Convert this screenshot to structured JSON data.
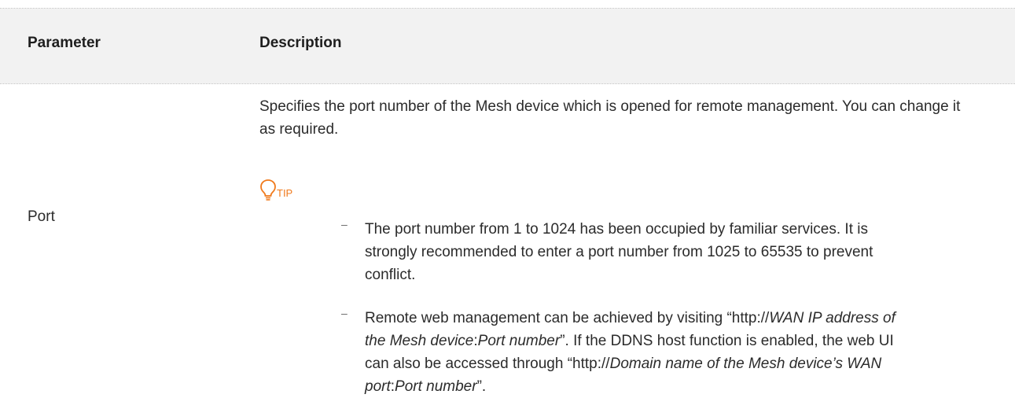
{
  "header": {
    "col_parameter": "Parameter",
    "col_description": "Description"
  },
  "row": {
    "parameter": "Port",
    "intro": "Specifies the port number of the Mesh device which is opened for remote management. You can change it as required.",
    "tip_label": "TIP",
    "tip_color": "#f07a1c",
    "bullets": [
      {
        "dash": "–",
        "text": "The port number from 1 to 1024 has been occupied by familiar services. It is strongly recommended to enter a port number from 1025 to 65535 to prevent conflict."
      },
      {
        "dash": "–",
        "parts": [
          "Remote web management can be achieved by visiting “http://",
          "WAN IP address of the Mesh device",
          ":",
          "Port number",
          "”. If the DDNS host function is enabled, the web UI can also be accessed through “http://",
          "Domain name of the Mesh device’s WAN port",
          ":",
          "Port number",
          "”."
        ]
      }
    ]
  }
}
